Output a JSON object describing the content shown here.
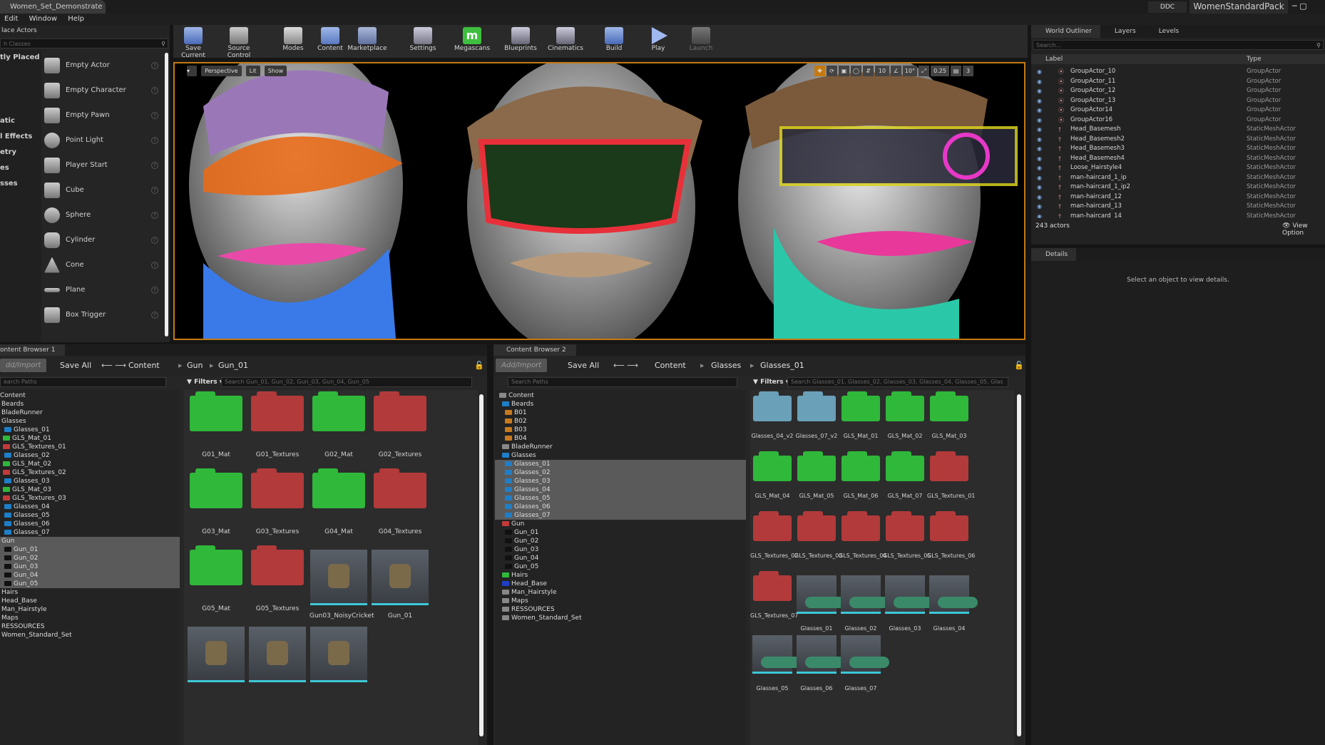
{
  "window": {
    "tab_title": "Women_Set_Demonstrate",
    "ddc_label": "DDC",
    "project_name": "WomenStandardPack"
  },
  "menu": [
    "Edit",
    "Window",
    "Help"
  ],
  "place_actors": {
    "title": "lace Actors",
    "search_placeholder": "h Classes",
    "categories": [
      "tly Placed",
      "",
      "",
      "atic",
      "l Effects",
      "etry",
      "es",
      "sses"
    ],
    "items": [
      "Empty Actor",
      "Empty Character",
      "Empty Pawn",
      "Point Light",
      "Player Start",
      "Cube",
      "Sphere",
      "Cylinder",
      "Cone",
      "Plane",
      "Box Trigger"
    ]
  },
  "toolbar": [
    "Save Current",
    "Source Control",
    "Modes",
    "Content",
    "Marketplace",
    "Settings",
    "Megascans",
    "Blueprints",
    "Cinematics",
    "Build",
    "Play",
    "Launch"
  ],
  "viewport": {
    "perspective": "Perspective",
    "lit": "Lit",
    "show": "Show",
    "grid_snap": "10",
    "rot_snap": "10°",
    "scale_snap": "0.25",
    "cam_speed": "3"
  },
  "outliner": {
    "tabs": [
      "World Outliner",
      "Layers",
      "Levels"
    ],
    "search_placeholder": "Search...",
    "col_label": "Label",
    "col_type": "Type",
    "rows": [
      {
        "label": "GroupActor_10",
        "type": "GroupActor"
      },
      {
        "label": "GroupActor_11",
        "type": "GroupActor"
      },
      {
        "label": "GroupActor_12",
        "type": "GroupActor"
      },
      {
        "label": "GroupActor_13",
        "type": "GroupActor"
      },
      {
        "label": "GroupActor14",
        "type": "GroupActor"
      },
      {
        "label": "GroupActor16",
        "type": "GroupActor"
      },
      {
        "label": "Head_Basemesh",
        "type": "StaticMeshActor"
      },
      {
        "label": "Head_Basemesh2",
        "type": "StaticMeshActor"
      },
      {
        "label": "Head_Basemesh3",
        "type": "StaticMeshActor"
      },
      {
        "label": "Head_Basemesh4",
        "type": "StaticMeshActor"
      },
      {
        "label": "Loose_Hairstyle4",
        "type": "StaticMeshActor"
      },
      {
        "label": "man-haircard_1_ip",
        "type": "StaticMeshActor"
      },
      {
        "label": "man-haircard_1_ip2",
        "type": "StaticMeshActor"
      },
      {
        "label": "man-haircard_12",
        "type": "StaticMeshActor"
      },
      {
        "label": "man-haircard_13",
        "type": "StaticMeshActor"
      },
      {
        "label": "man-haircard_14",
        "type": "StaticMeshActor"
      }
    ],
    "actor_count": "243 actors",
    "view_options": "View Option"
  },
  "details": {
    "tab": "Details",
    "empty_text": "Select an object to view details."
  },
  "cb1": {
    "tab": "ontent Browser 1",
    "add_import": "dd/Import",
    "save_all": "Save All",
    "crumbs": [
      "Content",
      "Gun",
      "Gun_01"
    ],
    "search_paths": "earch Paths",
    "filters": "Filters",
    "search_assets": "Search Gun_01, Gun_02, Gun_03, Gun_04, Gun_05",
    "tree": [
      {
        "label": "Content",
        "color": "",
        "sel": false
      },
      {
        "label": "Beards",
        "color": "",
        "sel": false
      },
      {
        "label": "BladeRunner",
        "color": "",
        "sel": false
      },
      {
        "label": "Glasses",
        "color": "",
        "sel": false
      },
      {
        "label": "Glasses_01",
        "color": "#1e7fc8",
        "sel": false
      },
      {
        "label": "GLS_Mat_01",
        "color": "#2fb83a",
        "sel": false
      },
      {
        "label": "GLS_Textures_01",
        "color": "#c23a3a",
        "sel": false
      },
      {
        "label": "Glasses_02",
        "color": "#1e7fc8",
        "sel": false
      },
      {
        "label": "GLS_Mat_02",
        "color": "#2fb83a",
        "sel": false
      },
      {
        "label": "GLS_Textures_02",
        "color": "#c23a3a",
        "sel": false
      },
      {
        "label": "Glasses_03",
        "color": "#1e7fc8",
        "sel": false
      },
      {
        "label": "GLS_Mat_03",
        "color": "#2fb83a",
        "sel": false
      },
      {
        "label": "GLS_Textures_03",
        "color": "#c23a3a",
        "sel": false
      },
      {
        "label": "Glasses_04",
        "color": "#1e7fc8",
        "sel": false
      },
      {
        "label": "Glasses_05",
        "color": "#1e7fc8",
        "sel": false
      },
      {
        "label": "Glasses_06",
        "color": "#1e7fc8",
        "sel": false
      },
      {
        "label": "Glasses_07",
        "color": "#1e7fc8",
        "sel": false
      },
      {
        "label": "Gun",
        "color": "",
        "sel": true
      },
      {
        "label": "Gun_01",
        "color": "#111",
        "sel": true
      },
      {
        "label": "Gun_02",
        "color": "#111",
        "sel": true
      },
      {
        "label": "Gun_03",
        "color": "#111",
        "sel": true
      },
      {
        "label": "Gun_04",
        "color": "#111",
        "sel": true
      },
      {
        "label": "Gun_05",
        "color": "#111",
        "sel": true
      },
      {
        "label": "Hairs",
        "color": "",
        "sel": false
      },
      {
        "label": "Head_Base",
        "color": "",
        "sel": false
      },
      {
        "label": "Man_Hairstyle",
        "color": "",
        "sel": false
      },
      {
        "label": "Maps",
        "color": "",
        "sel": false
      },
      {
        "label": "RESSOURCES",
        "color": "",
        "sel": false
      },
      {
        "label": "Women_Standard_Set",
        "color": "",
        "sel": false
      }
    ],
    "assets": [
      {
        "name": "G01_Mat",
        "kind": "green"
      },
      {
        "name": "G01_Textures",
        "kind": "red"
      },
      {
        "name": "G02_Mat",
        "kind": "green"
      },
      {
        "name": "G02_Textures",
        "kind": "red"
      },
      {
        "name": "G03_Mat",
        "kind": "green"
      },
      {
        "name": "G03_Textures",
        "kind": "red"
      },
      {
        "name": "G04_Mat",
        "kind": "green"
      },
      {
        "name": "G04_Textures",
        "kind": "red"
      },
      {
        "name": "G05_Mat",
        "kind": "green"
      },
      {
        "name": "G05_Textures",
        "kind": "red"
      },
      {
        "name": "Gun03_NoisyCricket",
        "kind": "thumb"
      },
      {
        "name": "Gun_01",
        "kind": "thumb"
      },
      {
        "name": "",
        "kind": "thumb"
      },
      {
        "name": "",
        "kind": "thumb"
      },
      {
        "name": "",
        "kind": "thumb"
      }
    ]
  },
  "cb2": {
    "tab": "Content Browser 2",
    "add_import": "Add/Import",
    "save_all": "Save All",
    "crumbs": [
      "Content",
      "Glasses",
      "Glasses_01"
    ],
    "search_paths": "Search Paths",
    "filters": "Filters",
    "search_assets": "Search Glasses_01, Glasses_02, Glasses_03, Glasses_04, Glasses_05, Glas",
    "tree": [
      {
        "label": "Content",
        "color": "#888",
        "sel": false
      },
      {
        "label": "Beards",
        "color": "#1e7fc8",
        "sel": false
      },
      {
        "label": "B01",
        "color": "#c87a1e",
        "sel": false
      },
      {
        "label": "B02",
        "color": "#c87a1e",
        "sel": false
      },
      {
        "label": "B03",
        "color": "#c87a1e",
        "sel": false
      },
      {
        "label": "B04",
        "color": "#c87a1e",
        "sel": false
      },
      {
        "label": "BladeRunner",
        "color": "#888",
        "sel": false
      },
      {
        "label": "Glasses",
        "color": "#1e7fc8",
        "sel": false
      },
      {
        "label": "Glasses_01",
        "color": "#1e7fc8",
        "sel": true
      },
      {
        "label": "Glasses_02",
        "color": "#1e7fc8",
        "sel": true
      },
      {
        "label": "Glasses_03",
        "color": "#1e7fc8",
        "sel": true
      },
      {
        "label": "Glasses_04",
        "color": "#1e7fc8",
        "sel": true
      },
      {
        "label": "Glasses_05",
        "color": "#1e7fc8",
        "sel": true
      },
      {
        "label": "Glasses_06",
        "color": "#1e7fc8",
        "sel": true
      },
      {
        "label": "Glasses_07",
        "color": "#1e7fc8",
        "sel": true
      },
      {
        "label": "Gun",
        "color": "#c23a3a",
        "sel": false
      },
      {
        "label": "Gun_01",
        "color": "#111",
        "sel": false
      },
      {
        "label": "Gun_02",
        "color": "#111",
        "sel": false
      },
      {
        "label": "Gun_03",
        "color": "#111",
        "sel": false
      },
      {
        "label": "Gun_04",
        "color": "#111",
        "sel": false
      },
      {
        "label": "Gun_05",
        "color": "#111",
        "sel": false
      },
      {
        "label": "Hairs",
        "color": "#2fb83a",
        "sel": false
      },
      {
        "label": "Head_Base",
        "color": "#1e3fc8",
        "sel": false
      },
      {
        "label": "Man_Hairstyle",
        "color": "#888",
        "sel": false
      },
      {
        "label": "Maps",
        "color": "#888",
        "sel": false
      },
      {
        "label": "RESSOURCES",
        "color": "#888",
        "sel": false
      },
      {
        "label": "Women_Standard_Set",
        "color": "#888",
        "sel": false
      }
    ],
    "assets": [
      {
        "name": "Glasses_04_v2",
        "kind": "blue"
      },
      {
        "name": "Glasses_07_v2",
        "kind": "blue"
      },
      {
        "name": "GLS_Mat_01",
        "kind": "green"
      },
      {
        "name": "GLS_Mat_02",
        "kind": "green"
      },
      {
        "name": "GLS_Mat_03",
        "kind": "green"
      },
      {
        "name": "GLS_Mat_04",
        "kind": "green"
      },
      {
        "name": "GLS_Mat_05",
        "kind": "green"
      },
      {
        "name": "GLS_Mat_06",
        "kind": "green"
      },
      {
        "name": "GLS_Mat_07",
        "kind": "green"
      },
      {
        "name": "GLS_Textures_01",
        "kind": "red"
      },
      {
        "name": "GLS_Textures_02",
        "kind": "red"
      },
      {
        "name": "GLS_Textures_03",
        "kind": "red"
      },
      {
        "name": "GLS_Textures_04",
        "kind": "red"
      },
      {
        "name": "GLS_Textures_05",
        "kind": "red"
      },
      {
        "name": "GLS_Textures_06",
        "kind": "red"
      },
      {
        "name": "GLS_Textures_07",
        "kind": "red"
      },
      {
        "name": "Glasses_01",
        "kind": "glass"
      },
      {
        "name": "Glasses_02",
        "kind": "glass"
      },
      {
        "name": "Glasses_03",
        "kind": "glass"
      },
      {
        "name": "Glasses_04",
        "kind": "glass"
      },
      {
        "name": "Glasses_05",
        "kind": "glass"
      },
      {
        "name": "Glasses_06",
        "kind": "glass"
      },
      {
        "name": "Glasses_07",
        "kind": "glass"
      }
    ]
  },
  "colors": {
    "accent_orange": "#c47a10",
    "folder_green": "#2fb83a",
    "folder_red": "#b33a3a",
    "folder_blue": "#6aa0b8",
    "selection_cyan": "#3cc8d8"
  }
}
